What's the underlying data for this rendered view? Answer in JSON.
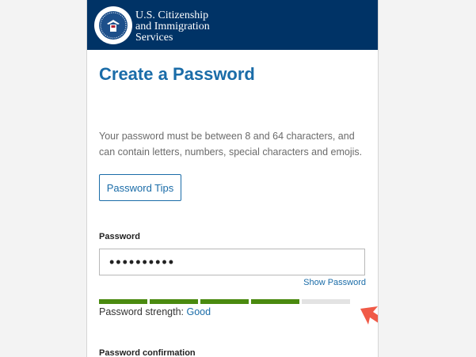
{
  "header": {
    "agency_lines": [
      "U.S. Citizenship",
      "and Immigration",
      "Services"
    ],
    "seal_icon": "dhs-seal-icon",
    "background": "#003366"
  },
  "main": {
    "title": "Create a Password",
    "description": "Your password must be between 8 and 64 characters, and can contain letters, numbers, special characters and emojis.",
    "tips_button": "Password Tips",
    "password_label": "Password",
    "password_value": "••••••••••",
    "show_password": "Show Password",
    "strength": {
      "label": "Password strength:",
      "value": "Good",
      "filled_segments": 4,
      "total_segments": 5,
      "filled_color": "#4a8a0f",
      "empty_color": "#e3e3e3"
    },
    "confirmation_label": "Password confirmation"
  },
  "annotation": {
    "arrow_color": "#f05a47"
  }
}
